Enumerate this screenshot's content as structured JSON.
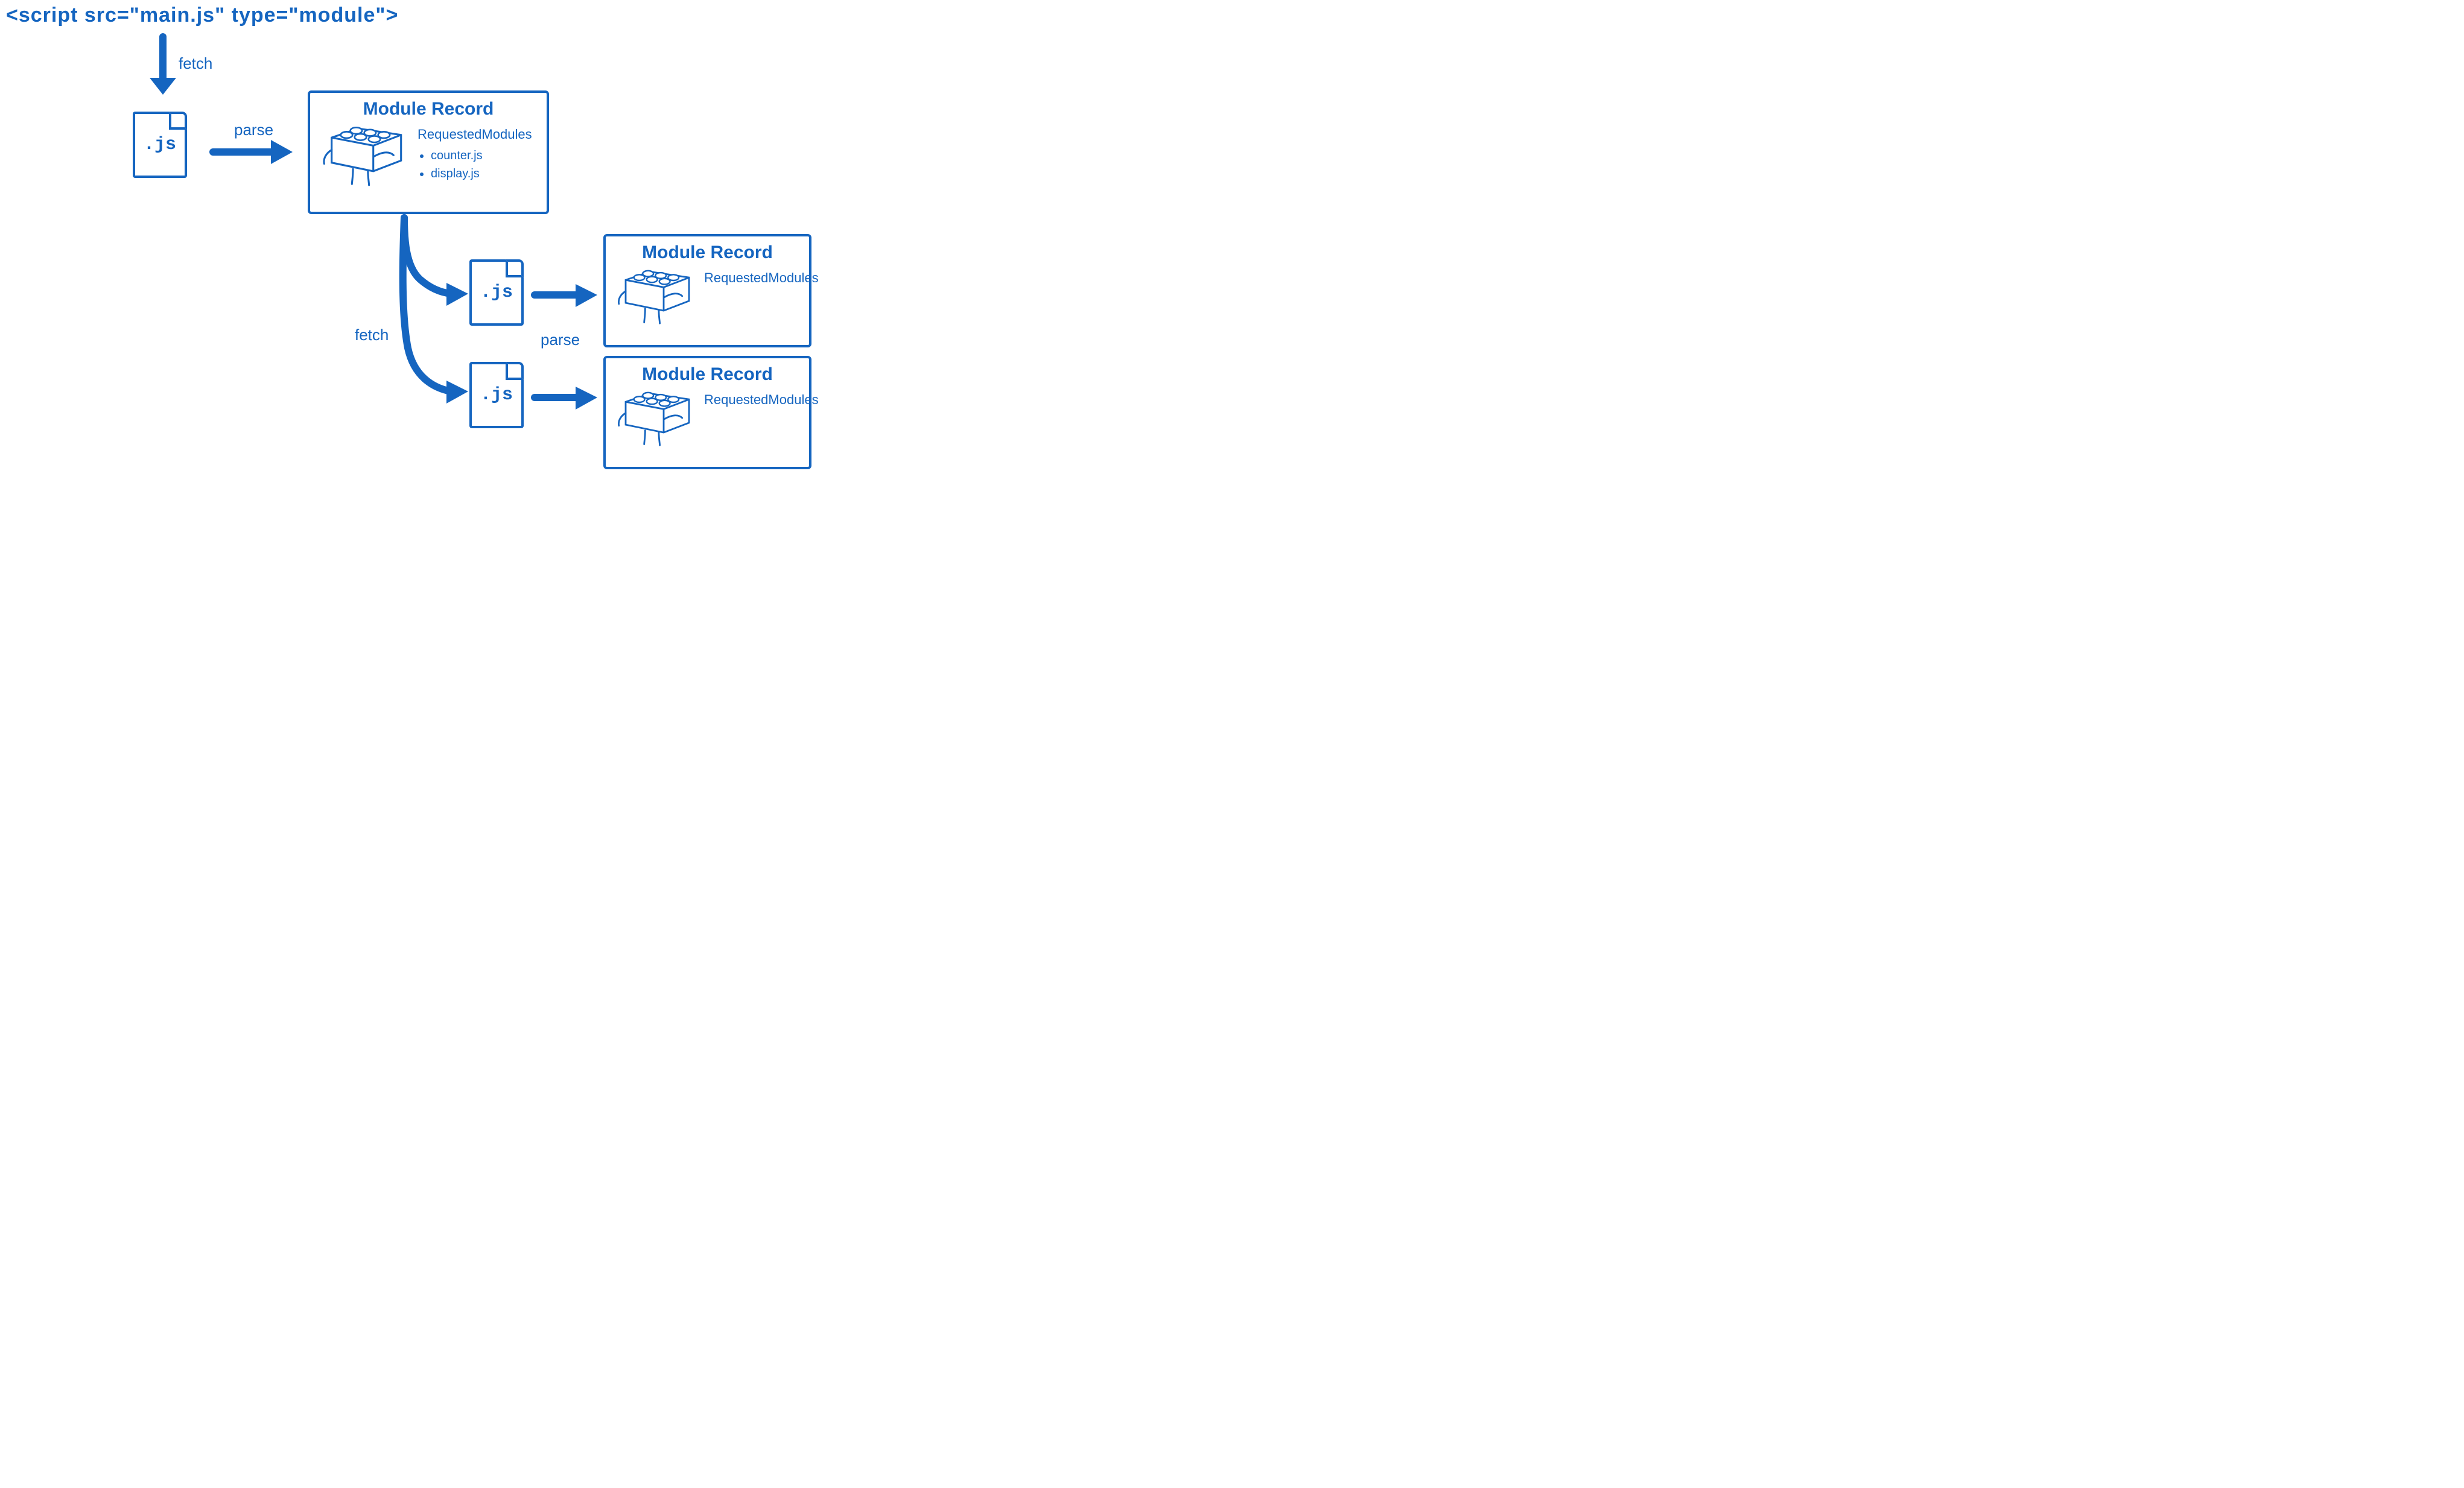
{
  "script_tag": "<script src=\"main.js\" type=\"module\">",
  "labels": {
    "fetch1": "fetch",
    "parse1": "parse",
    "fetch2": "fetch",
    "parse2": "parse"
  },
  "files": {
    "main": ".js",
    "child1": ".js",
    "child2": ".js"
  },
  "records": {
    "main": {
      "title": "Module Record",
      "requested_heading": "RequestedModules",
      "requested": [
        "counter.js",
        "display.js"
      ]
    },
    "child1": {
      "title": "Module Record",
      "requested_heading": "RequestedModules"
    },
    "child2": {
      "title": "Module Record",
      "requested_heading": "RequestedModules"
    }
  }
}
